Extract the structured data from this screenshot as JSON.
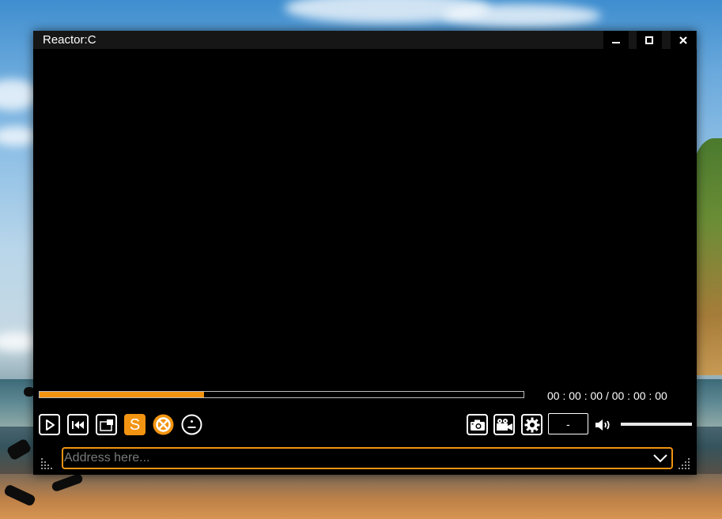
{
  "window": {
    "title": "Reactor:C",
    "controls": {
      "minimize_icon": "minimize-icon",
      "maximize_icon": "maximize-icon",
      "close_icon": "close-icon"
    }
  },
  "playback": {
    "progress_fraction": 0.34,
    "time_display": "00 : 00 : 00 / 00 : 00 : 00"
  },
  "controls_left": [
    {
      "name": "play-button",
      "icon": "play-icon"
    },
    {
      "name": "previous-button",
      "icon": "skip-back-icon"
    },
    {
      "name": "popout-button",
      "icon": "window-popout-icon"
    },
    {
      "name": "subtitle-button",
      "icon": "subtitle-s-icon",
      "label": "S"
    },
    {
      "name": "stop-button",
      "icon": "x-circle-icon"
    },
    {
      "name": "mood-button",
      "icon": "neutral-face-icon"
    }
  ],
  "controls_right": [
    {
      "name": "snapshot-button",
      "icon": "camera-icon"
    },
    {
      "name": "record-button",
      "icon": "video-camera-icon"
    },
    {
      "name": "settings-button",
      "icon": "gear-icon"
    }
  ],
  "quality_box": {
    "value": "-"
  },
  "volume": {
    "icon": "speaker-icon",
    "level_fraction": 1.0
  },
  "address_bar": {
    "placeholder": "Address here...",
    "value": "",
    "dropdown_icon": "chevron-down-icon"
  },
  "colors": {
    "accent": "#f29411",
    "background": "#000000",
    "titlebar": "#161616",
    "text": "#ffffff"
  }
}
